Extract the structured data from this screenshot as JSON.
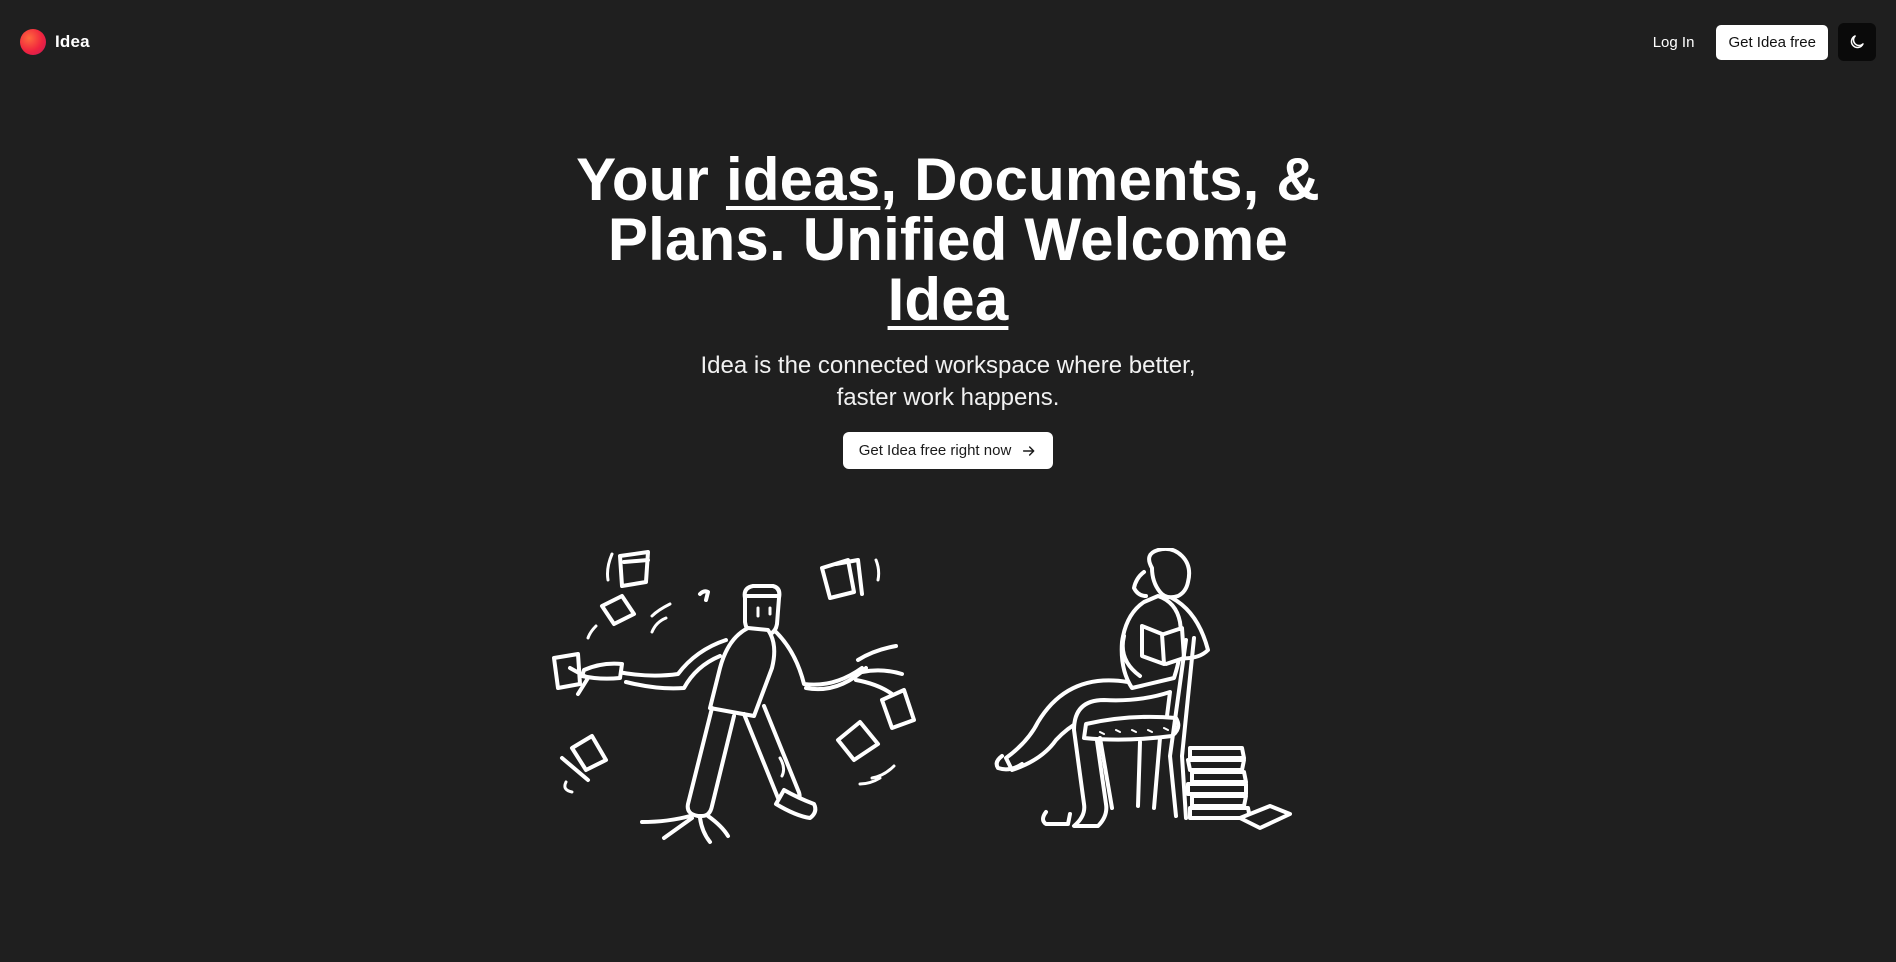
{
  "nav": {
    "brand": "Idea",
    "login_label": "Log In",
    "cta_label": "Get Idea free",
    "theme_icon": "moon-icon"
  },
  "hero": {
    "headline_part1": "Your ",
    "headline_ideas": "ideas",
    "headline_part2": ", Documents, & Plans. Unified Welcome ",
    "headline_idea": "Idea",
    "subtitle": "Idea is the connected workspace where better, faster work happens.",
    "cta_label": "Get Idea free right now",
    "cta_icon": "arrow-right-icon"
  },
  "colors": {
    "background": "#1f1f1f",
    "text": "#ffffff",
    "logo_gradient": [
      "#ff6a3d",
      "#c2185b"
    ]
  }
}
